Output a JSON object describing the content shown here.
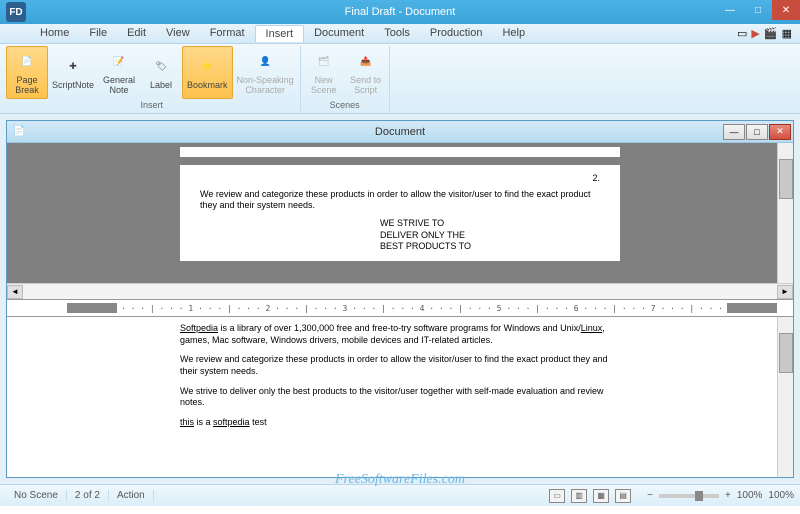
{
  "app": {
    "title": "Final Draft - Document",
    "icon_label": "FD"
  },
  "window_controls": {
    "min": "—",
    "max": "□",
    "close": "✕"
  },
  "menu": {
    "items": [
      "Home",
      "File",
      "Edit",
      "View",
      "Format",
      "Insert",
      "Document",
      "Tools",
      "Production",
      "Help"
    ],
    "active_index": 5
  },
  "ribbon": {
    "groups": [
      {
        "label": "Insert",
        "buttons": [
          {
            "label": "Page\nBreak",
            "icon": "📄",
            "style": "orange"
          },
          {
            "label": "ScriptNote",
            "icon": "✚",
            "style": ""
          },
          {
            "label": "General\nNote",
            "icon": "📝",
            "style": ""
          },
          {
            "label": "Label",
            "icon": "🏷",
            "style": ""
          },
          {
            "label": "Bookmark",
            "icon": "⭐",
            "style": "orange"
          },
          {
            "label": "Non-Speaking\nCharacter",
            "icon": "👤",
            "style": "disabled"
          }
        ]
      },
      {
        "label": "Scenes",
        "buttons": [
          {
            "label": "New\nScene",
            "icon": "🗂",
            "style": "disabled"
          },
          {
            "label": "Send to\nScript",
            "icon": "📤",
            "style": "disabled"
          }
        ]
      }
    ]
  },
  "doc_window": {
    "title": "Document",
    "controls": {
      "min": "—",
      "max": "□",
      "close": "✕"
    }
  },
  "page_top": {
    "page_number": "2.",
    "body": "We review and categorize these products in order to allow the visitor/user to find the exact product they and their system needs.",
    "centered": [
      "WE STRIVE TO",
      "DELIVER ONLY THE",
      "BEST PRODUCTS TO"
    ]
  },
  "ruler_text": "· · · | · · · 1 · · · | · · · 2 · · · | · · · 3 · · · | · · · 4 · · · | · · · 5 · · · | · · · 6 · · · | · · · 7 · · · | · · ·",
  "page_bottom": {
    "p1_a": "Softpedia",
    "p1_b": " is a library of over 1,300,000 free and free-to-try software programs for Windows and Unix/",
    "p1_c": "Linux",
    "p1_d": ", games, Mac software, Windows drivers, mobile devices and IT-related articles.",
    "p2": "We review and categorize these products in order to allow the visitor/user to find the exact product they and their system needs.",
    "p3": "We strive to deliver only the best products to the visitor/user together with self-made evaluation and review notes.",
    "p4_a": "this",
    "p4_b": " is a ",
    "p4_c": "softpedia",
    "p4_d": " test"
  },
  "status": {
    "scene": "No Scene",
    "page": "2 of 2",
    "element": "Action",
    "zoom_label": "100%",
    "zoom_label2": "100%"
  },
  "watermark": "FreeSoftwareFiles.com"
}
